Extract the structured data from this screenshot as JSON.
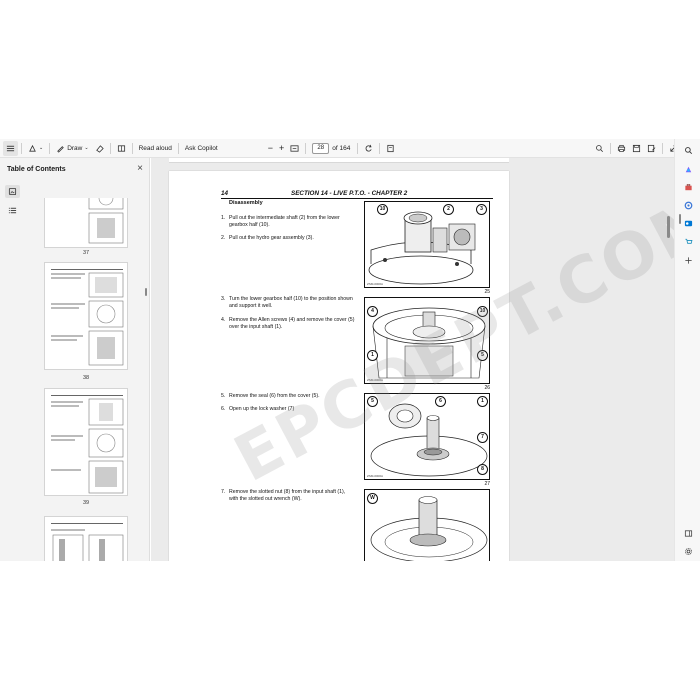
{
  "toolbar": {
    "draw_label": "Draw",
    "read_aloud_label": "Read aloud",
    "ask_copilot_label": "Ask Copilot",
    "minus_label": "−",
    "plus_label": "+",
    "page_current": "28",
    "page_total_label": "of 164"
  },
  "toc": {
    "title": "Table of Contents",
    "close_glyph": "×"
  },
  "thumbnails": [
    {
      "label": "37"
    },
    {
      "label": "38"
    },
    {
      "label": "39"
    },
    {
      "label": ""
    }
  ],
  "document": {
    "page_number": "14",
    "section_title": "SECTION 14 - LIVE P.T.O. - CHAPTER 2",
    "section_heading": "Disassembly",
    "steps": [
      {
        "n": "1.",
        "text": "Pull out the intermediate shaft (2) from the lower gearbox half (10)."
      },
      {
        "n": "2.",
        "text": "Pull out the hydro gear assembly (3)."
      },
      {
        "n": "3.",
        "text": "Turn the lower gearbox half (10) to the position shown and support it well."
      },
      {
        "n": "4.",
        "text": "Remove the Allen screws (4) and remove the cover (5) over the input shaft (1)."
      },
      {
        "n": "5.",
        "text": "Remove the seal (6) from the cover (5)."
      },
      {
        "n": "6.",
        "text": "Open up the lock washer (7)"
      },
      {
        "n": "7.",
        "text": "Remove the slotted nut (8) from the input shaft (1), with the slotted out wrench (W)."
      }
    ],
    "figures": [
      {
        "number": "25",
        "code": "ZSM-0000A",
        "callouts": [
          "10",
          "2",
          "3"
        ]
      },
      {
        "number": "26",
        "code": "ZSM-0000A",
        "callouts": [
          "4",
          "10",
          "1",
          "5"
        ]
      },
      {
        "number": "27",
        "code": "ZSM-0000A",
        "callouts": [
          "5",
          "6",
          "1",
          "7",
          "8"
        ]
      },
      {
        "number": "",
        "code": "",
        "callouts": [
          "W"
        ]
      }
    ]
  },
  "watermark_text": "EPCDEPT.COM",
  "colors": {
    "accent_blue": "#0067c0",
    "toolbar_bg": "#f7f7f7",
    "panel_bg": "#f3f3f3",
    "doc_bg": "#ebebeb"
  },
  "icons": {
    "left_rail": [
      "thumbnails-icon",
      "outline-list-icon"
    ],
    "right_rail": [
      "search-bing-icon",
      "copilot-icon",
      "briefcase-icon",
      "circle-app-icon",
      "outlook-icon",
      "shopping-icon",
      "add-icon",
      "split-view-icon",
      "settings-icon"
    ]
  }
}
